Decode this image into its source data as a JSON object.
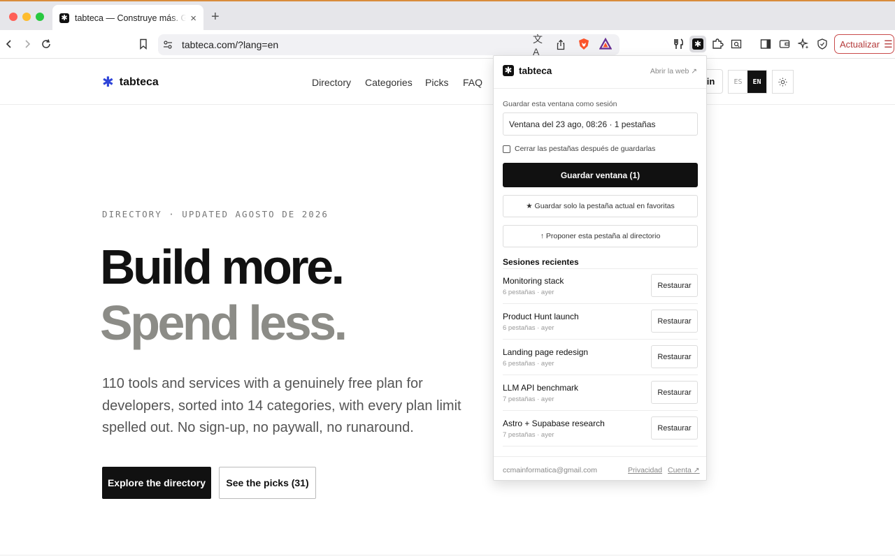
{
  "browser": {
    "tab_title": "tabteca — Construye más. Gasta menos.",
    "tab_favicon": "tabteca-icon",
    "close_glyph": "×",
    "new_tab_glyph": "+",
    "url": "tabteca.com/?lang=en",
    "update_label": "Actualizar"
  },
  "site": {
    "logo_text": "tabteca",
    "nav": [
      "Directory",
      "Categories",
      "Picks",
      "FAQ"
    ],
    "signin_fragment": "in",
    "lang": {
      "es": "ES",
      "en": "EN",
      "active": "EN"
    }
  },
  "hero": {
    "eyebrow": "DIRECTORY · UPDATED AGOSTO DE 2026",
    "line1": "Build more.",
    "line2": "Spend less.",
    "description": "110 tools and services with a genuinely free plan for developers, sorted into 14 categories, with every plan limit spelled out. No sign-up, no paywall, no runaround.",
    "cta_primary": "Explore the directory",
    "cta_secondary": "See the picks (31)"
  },
  "popup": {
    "brand": "tabteca",
    "open_web": "Abrir la web ↗",
    "save_label": "Guardar esta ventana como sesión",
    "session_name_value": "Ventana del 23 ago, 08:26 · 1 pestañas",
    "close_tabs_label": "Cerrar las pestañas después de guardarlas",
    "close_tabs_checked": false,
    "save_button": "Guardar ventana (1)",
    "fav_button": "★ Guardar solo la pestaña actual en favoritas",
    "propose_button": "↑ Proponer esta pestaña al directorio",
    "recent_title": "Sesiones recientes",
    "sessions": [
      {
        "name": "Monitoring stack",
        "meta": "6 pestañas · ayer",
        "action": "Restaurar"
      },
      {
        "name": "Product Hunt launch",
        "meta": "6 pestañas · ayer",
        "action": "Restaurar"
      },
      {
        "name": "Landing page redesign",
        "meta": "6 pestañas · ayer",
        "action": "Restaurar"
      },
      {
        "name": "LLM API benchmark",
        "meta": "7 pestañas · ayer",
        "action": "Restaurar"
      },
      {
        "name": "Astro + Supabase research",
        "meta": "7 pestañas · ayer",
        "action": "Restaurar"
      }
    ],
    "footer_email": "ccmainformatica@gmail.com",
    "privacy_link": "Privacidad",
    "account_link": "Cuenta ↗"
  },
  "colors": {
    "accent": "#111111",
    "logo_mark": "#2f45d8",
    "hero_secondary": "#8c8c87",
    "update_red": "#c94b4b"
  }
}
